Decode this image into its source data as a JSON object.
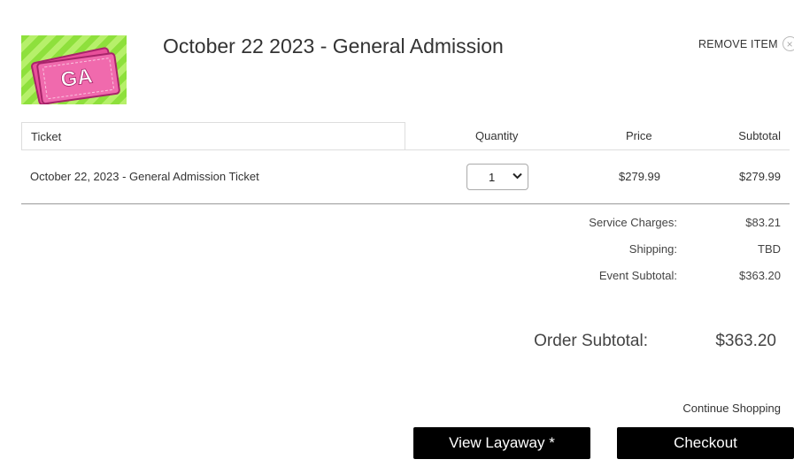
{
  "item": {
    "image_text": "GA",
    "title": "October 22 2023 - General Admission",
    "remove_label": "REMOVE ITEM",
    "remove_icon": "close-circle-icon"
  },
  "table": {
    "headers": {
      "ticket": "Ticket",
      "quantity": "Quantity",
      "price": "Price",
      "subtotal": "Subtotal"
    },
    "rows": [
      {
        "ticket": "October 22, 2023 - General Admission Ticket",
        "quantity": "1",
        "price": "$279.99",
        "subtotal": "$279.99"
      }
    ]
  },
  "summary": {
    "service_label": "Service Charges:",
    "service_value": "$83.21",
    "shipping_label": "Shipping:",
    "shipping_value": "TBD",
    "event_label": "Event Subtotal:",
    "event_value": "$363.20"
  },
  "order": {
    "label": "Order Subtotal:",
    "value": "$363.20"
  },
  "actions": {
    "continue": "Continue Shopping",
    "layaway": "View Layaway *",
    "checkout": "Checkout"
  },
  "colors": {
    "button_bg": "#000000",
    "ticket_pink": "#e84f9a",
    "stripe_green": "#8ee03c"
  }
}
